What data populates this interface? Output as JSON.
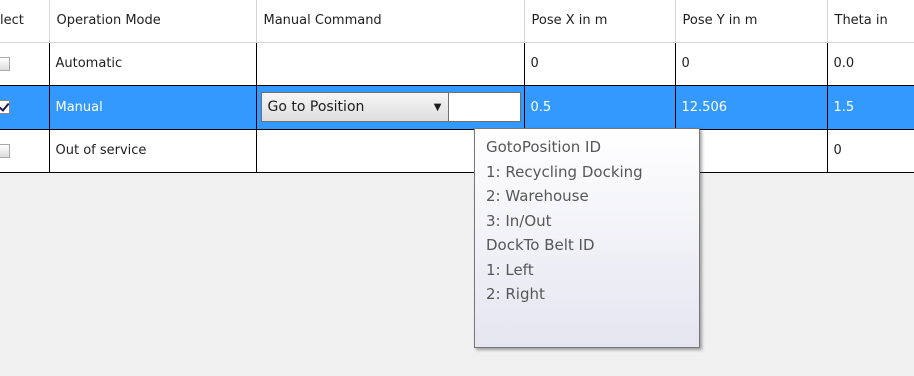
{
  "headers": {
    "select": "lect",
    "operation_mode": "Operation Mode",
    "manual_command": "Manual Command",
    "pose_x": "Pose X in m",
    "pose_y": "Pose Y in m",
    "theta": "Theta in"
  },
  "rows": [
    {
      "checked": false,
      "operation_mode": "Automatic",
      "manual_command": "",
      "pose_x": "0",
      "pose_y": "0",
      "theta": "0.0"
    },
    {
      "checked": true,
      "operation_mode": "Manual",
      "manual_command": "Go to Position",
      "pose_x": "0.5",
      "pose_y": "12.506",
      "theta": "1.5"
    },
    {
      "checked": false,
      "operation_mode": "Out of service",
      "manual_command": "",
      "pose_x": "",
      "pose_y": "",
      "theta": "0"
    }
  ],
  "tooltip": {
    "lines": [
      "GotoPosition ID",
      "1: Recycling Docking",
      "2: Warehouse",
      "3: In/Out",
      "DockTo Belt ID",
      "1: Left",
      "2: Right"
    ]
  },
  "colors": {
    "selection": "#3399ff",
    "grid_background": "#ffffff",
    "empty_area": "#f0f0f0"
  }
}
